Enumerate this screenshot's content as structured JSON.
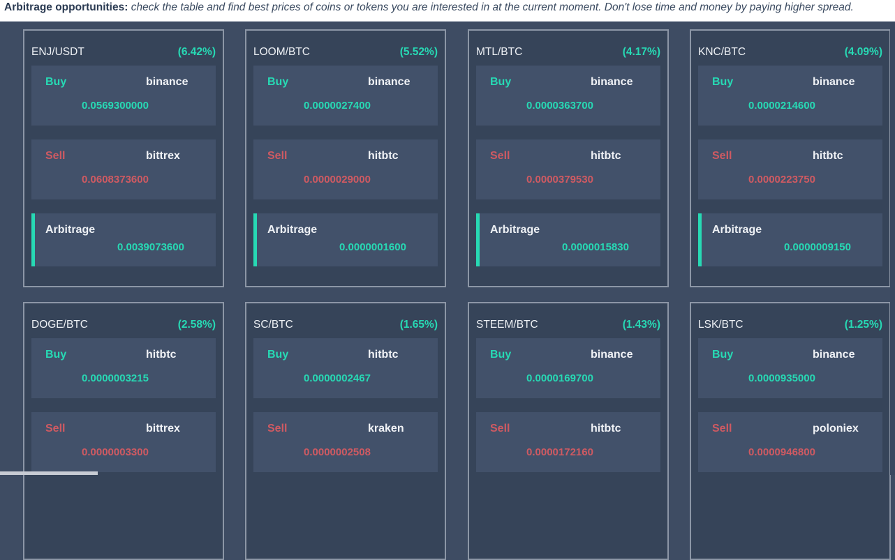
{
  "header": {
    "label": "Arbitrage opportunities:",
    "description": "check the table and find best prices of coins or tokens you are interested in at the current moment. Don't lose time and money by paying higher spread."
  },
  "labels": {
    "buy": "Buy",
    "sell": "Sell",
    "arbitrage": "Arbitrage"
  },
  "colors": {
    "accent": "#27d9b4",
    "sell": "#cf5a62",
    "card_bg": "#364459",
    "box_bg": "#42516a",
    "page_bg": "#3e4c63"
  },
  "cards": [
    {
      "pair": "ENJ/USDT",
      "percent": "(6.42%)",
      "buy_exchange": "binance",
      "buy_price": "0.0569300000",
      "sell_exchange": "bittrex",
      "sell_price": "0.0608373600",
      "arbitrage": "0.0039073600"
    },
    {
      "pair": "LOOM/BTC",
      "percent": "(5.52%)",
      "buy_exchange": "binance",
      "buy_price": "0.0000027400",
      "sell_exchange": "hitbtc",
      "sell_price": "0.0000029000",
      "arbitrage": "0.0000001600"
    },
    {
      "pair": "MTL/BTC",
      "percent": "(4.17%)",
      "buy_exchange": "binance",
      "buy_price": "0.0000363700",
      "sell_exchange": "hitbtc",
      "sell_price": "0.0000379530",
      "arbitrage": "0.0000015830"
    },
    {
      "pair": "KNC/BTC",
      "percent": "(4.09%)",
      "buy_exchange": "binance",
      "buy_price": "0.0000214600",
      "sell_exchange": "hitbtc",
      "sell_price": "0.0000223750",
      "arbitrage": "0.0000009150"
    },
    {
      "pair": "DOGE/BTC",
      "percent": "(2.58%)",
      "buy_exchange": "hitbtc",
      "buy_price": "0.0000003215",
      "sell_exchange": "bittrex",
      "sell_price": "0.0000003300"
    },
    {
      "pair": "SC/BTC",
      "percent": "(1.65%)",
      "buy_exchange": "hitbtc",
      "buy_price": "0.0000002467",
      "sell_exchange": "kraken",
      "sell_price": "0.0000002508"
    },
    {
      "pair": "STEEM/BTC",
      "percent": "(1.43%)",
      "buy_exchange": "binance",
      "buy_price": "0.0000169700",
      "sell_exchange": "hitbtc",
      "sell_price": "0.0000172160"
    },
    {
      "pair": "LSK/BTC",
      "percent": "(1.25%)",
      "buy_exchange": "binance",
      "buy_price": "0.0000935000",
      "sell_exchange": "poloniex",
      "sell_price": "0.0000946800"
    }
  ]
}
